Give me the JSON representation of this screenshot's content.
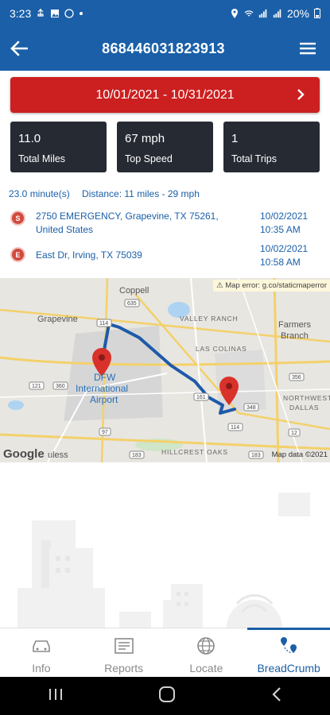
{
  "status_bar": {
    "time": "3:23",
    "battery": "20%"
  },
  "app_bar": {
    "title": "868446031823913"
  },
  "date_range": {
    "label": "10/01/2021 - 10/31/2021"
  },
  "stats": [
    {
      "value": "11.0",
      "label": "Total Miles"
    },
    {
      "value": "67 mph",
      "label": "Top Speed"
    },
    {
      "value": "1",
      "label": "Total Trips"
    }
  ],
  "trip": {
    "duration": "23.0 minute(s)",
    "distance": "Distance: 11 miles - 29 mph",
    "start": {
      "marker": "S",
      "address": "2750 EMERGENCY, Grapevine, TX 75261, United States",
      "date": "10/02/2021",
      "time": "10:35 AM"
    },
    "end": {
      "marker": "E",
      "address": "East Dr, Irving, TX 75039",
      "date": "10/02/2021",
      "time": "10:58 AM"
    }
  },
  "map": {
    "error": "Map error: g.co/staticmaperror",
    "credit": "Map data ©2021",
    "logo": "Google",
    "labels": {
      "coppell": "Coppell",
      "grapevine": "Grapevine",
      "valley_ranch": "VALLEY RANCH",
      "farmers_branch_1": "Farmers",
      "farmers_branch_2": "Branch",
      "dfw_1": "DFW",
      "dfw_2": "International",
      "dfw_3": "Airport",
      "las_colinas": "LAS COLINAS",
      "northwest_1": "NORTHWEST",
      "northwest_2": "DALLAS",
      "hillcrest": "HILLCREST OAKS",
      "euless": "uless",
      "r635": "635",
      "r114a": "114",
      "r121": "121",
      "r360": "360",
      "r97": "97",
      "r183": "183",
      "r161": "161",
      "r348": "348",
      "r114b": "114",
      "r356": "356",
      "r12": "12",
      "r183b": "183"
    }
  },
  "bottom_nav": [
    {
      "label": "Info",
      "icon": "car-icon"
    },
    {
      "label": "Reports",
      "icon": "reports-icon"
    },
    {
      "label": "Locate",
      "icon": "globe-icon"
    },
    {
      "label": "BreadCrumb",
      "icon": "breadcrumb-icon",
      "active": true
    }
  ],
  "colors": {
    "primary": "#1a5fa8",
    "accent": "#cc1f1f",
    "card": "#262a33",
    "route": "#1e5aa8",
    "pin": "#d8322b"
  }
}
